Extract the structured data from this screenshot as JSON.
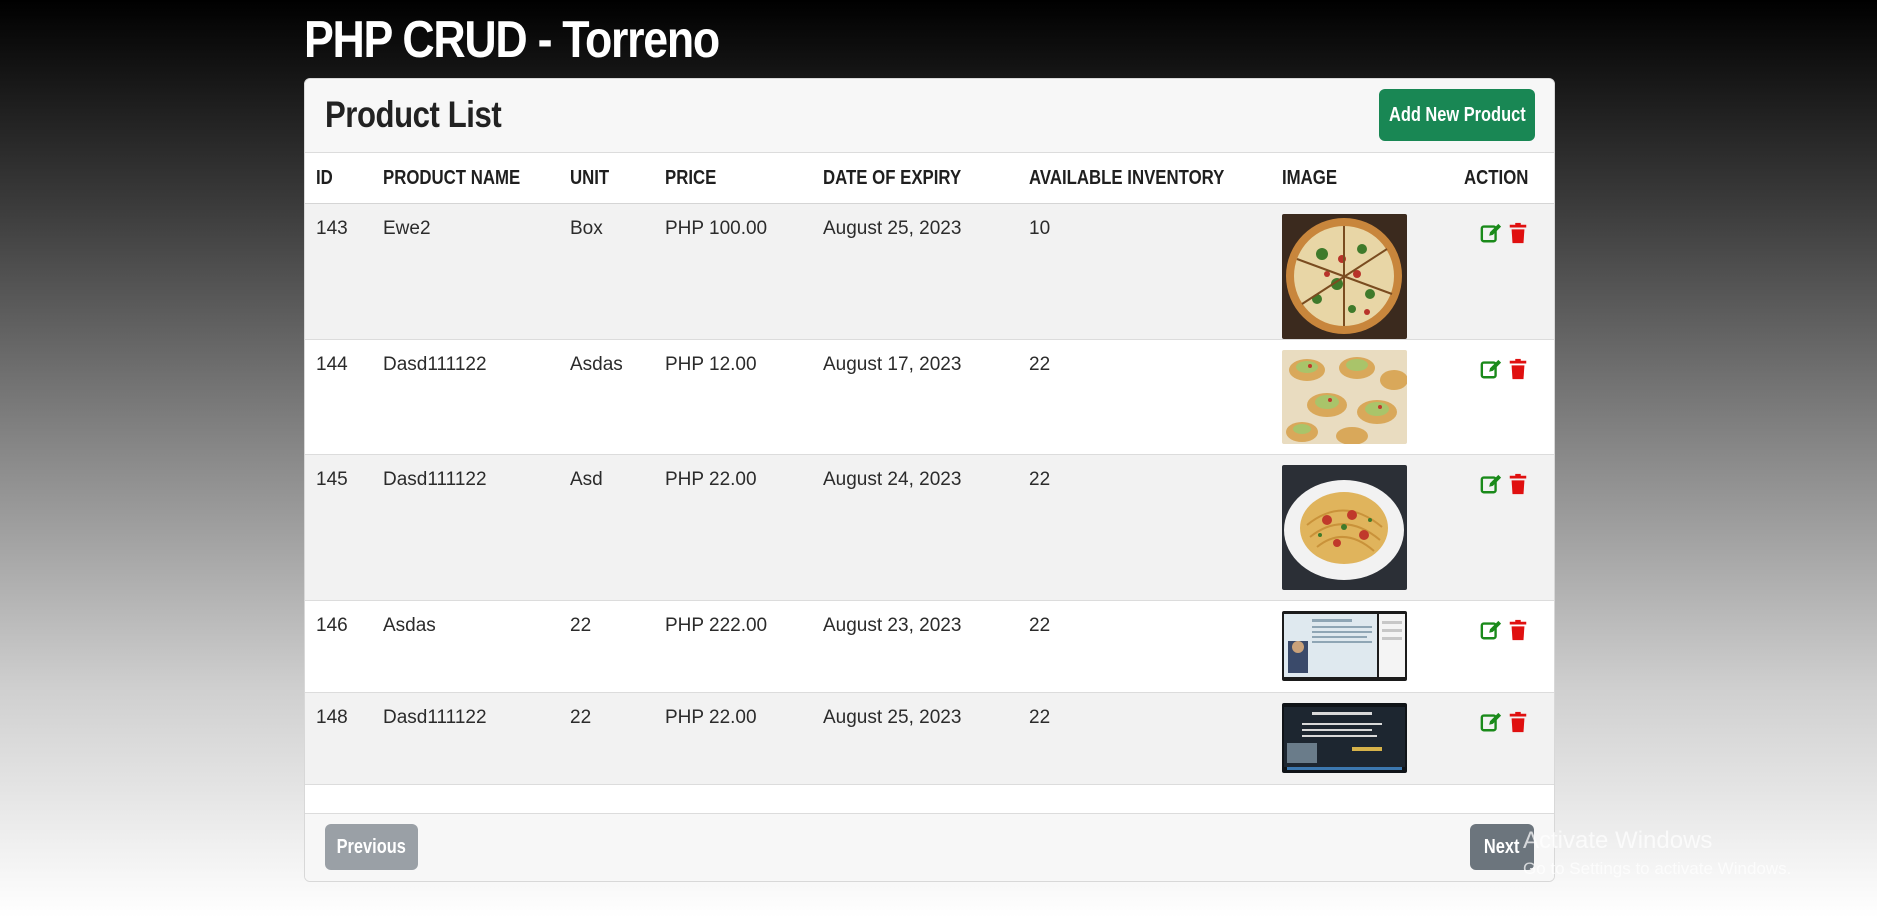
{
  "app_title": "PHP CRUD - Torreno",
  "card": {
    "title": "Product List",
    "add_button": "Add New Product"
  },
  "table": {
    "columns": [
      "ID",
      "PRODUCT NAME",
      "UNIT",
      "PRICE",
      "DATE OF EXPIRY",
      "AVAILABLE INVENTORY",
      "IMAGE",
      "ACTION"
    ],
    "rows": [
      {
        "id": "143",
        "name": "Ewe2",
        "unit": "Box",
        "price": "PHP 100.00",
        "expiry": "August 25, 2023",
        "inventory": "10",
        "image": "pizza-image"
      },
      {
        "id": "144",
        "name": "Dasd111122",
        "unit": "Asdas",
        "price": "PHP 12.00",
        "expiry": "August 17, 2023",
        "inventory": "22",
        "image": "crostini-image"
      },
      {
        "id": "145",
        "name": "Dasd111122",
        "unit": "Asd",
        "price": "PHP 22.00",
        "expiry": "August 24, 2023",
        "inventory": "22",
        "image": "spaghetti-image"
      },
      {
        "id": "146",
        "name": "Asdas",
        "unit": "22",
        "price": "PHP 222.00",
        "expiry": "August 23, 2023",
        "inventory": "22",
        "image": "slide-screenshot-image"
      },
      {
        "id": "148",
        "name": "Dasd111122",
        "unit": "22",
        "price": "PHP 22.00",
        "expiry": "August 25, 2023",
        "inventory": "22",
        "image": "dark-slide-screenshot-image"
      }
    ]
  },
  "pagination": {
    "previous_label": "Previous",
    "next_label": "Next"
  },
  "watermark": {
    "title": "Activate Windows",
    "subtitle": "Go to Settings to activate Windows."
  },
  "icons": {
    "edit": "edit-icon",
    "delete": "trash-icon"
  },
  "colors": {
    "add_button": "#198754",
    "edit_icon": "#1a8a1a",
    "delete_icon": "#e01010",
    "next_button": "#6c757d",
    "previous_button": "#9aa0a6"
  }
}
